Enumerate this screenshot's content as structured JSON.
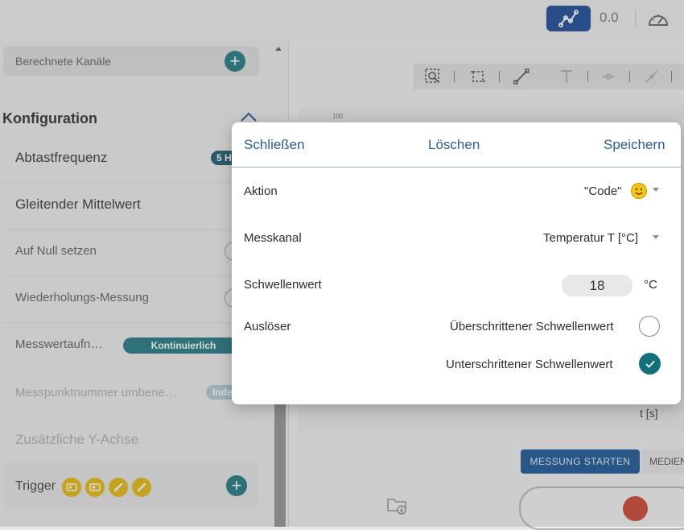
{
  "topbar": {
    "graph_icon": "graph-line-icon",
    "value_readout": "0.0",
    "gauge_icon": "gauge-icon"
  },
  "sidebar": {
    "calculated_channels_label": "Berechnete Kanäle",
    "configuration_title": "Konfiguration",
    "items": [
      {
        "label": "Abtastfrequenz",
        "badge": "5 H"
      },
      {
        "label": "Gleitender Mittelwert"
      },
      {
        "label": "Auf Null setzen"
      },
      {
        "label": "Wiederholungs-Messung"
      },
      {
        "label": "Messwertaufn…",
        "badge": "Kontinuierlich"
      },
      {
        "label": "Messpunktnummer umbene…",
        "badge": "Inde"
      },
      {
        "label": "Zusätzliche Y-Achse"
      }
    ],
    "trigger_label": "Trigger",
    "trigger_icons": [
      "sensor-icon",
      "sensor-icon",
      "pen-icon",
      "pen-icon"
    ]
  },
  "chart": {
    "toolbar_icons": [
      "zoom-select-icon",
      "crop-icon",
      "line-tool-icon",
      "text-icon",
      "marker-icon",
      "tangent-icon"
    ],
    "y_tick_top": "100",
    "x_axis_label": "t [s]"
  },
  "controls": {
    "start_label": "MESSUNG STARTEN",
    "median_label": "MEDIEN",
    "folder_icon": "folder-download-icon",
    "record_color": "#c83a24"
  },
  "dialog": {
    "close_label": "Schließen",
    "delete_label": "Löschen",
    "save_label": "Speichern",
    "action_label": "Aktion",
    "action_value": "\"Code\"",
    "channel_label": "Messkanal",
    "channel_value": "Temperatur T [°C]",
    "threshold_label": "Schwellenwert",
    "threshold_value": "18",
    "threshold_unit": "°C",
    "trigger_label": "Auslöser",
    "options": [
      {
        "label": "Überschrittener Schwellenwert",
        "selected": false
      },
      {
        "label": "Unterschrittener Schwellenwert",
        "selected": true
      }
    ]
  },
  "colors": {
    "accent_teal": "#14707a",
    "primary_blue": "#0b3d91",
    "link_blue": "#2b5e8f"
  }
}
